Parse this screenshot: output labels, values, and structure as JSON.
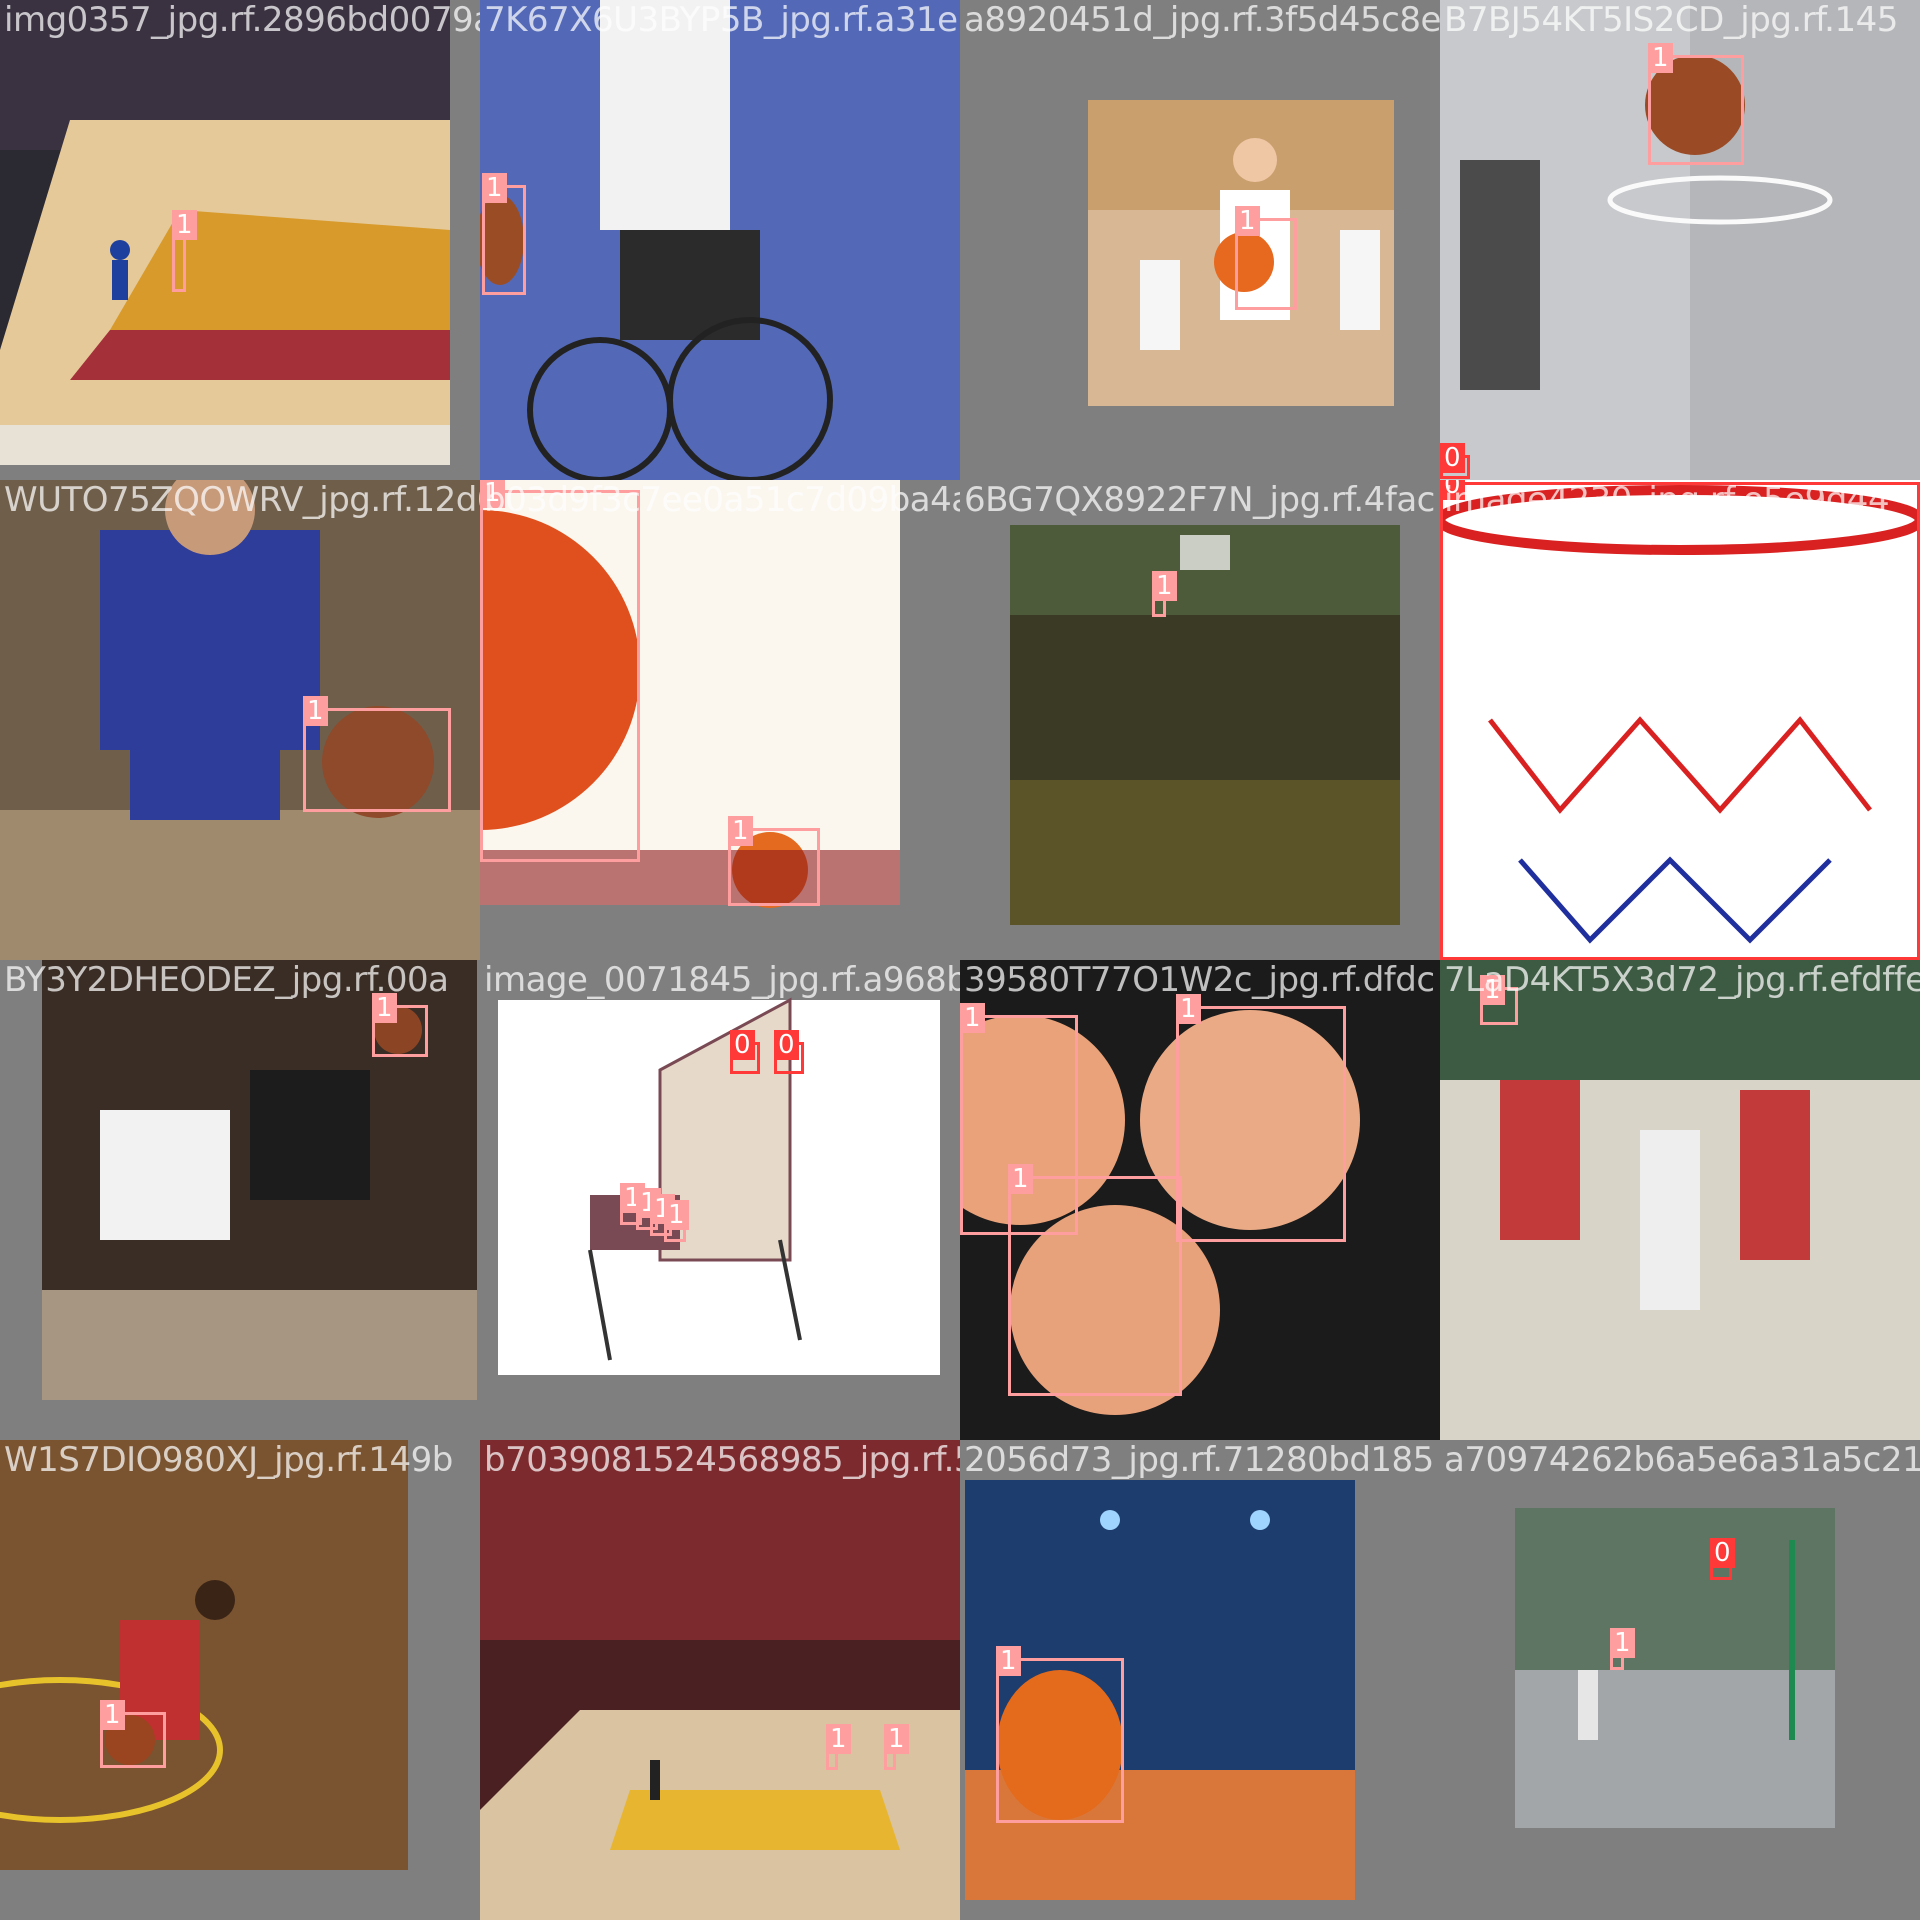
{
  "colors": {
    "class_0": "#ff3838",
    "class_1": "#ff9e9e",
    "background": "#7f7f7f"
  },
  "tiles": [
    {
      "filename": "img0357_jpg.rf.2896bd0079a4f6e7cc0b1b9c59",
      "scene": "court-arena",
      "boxes": [
        {
          "label": "1"
        }
      ]
    },
    {
      "filename": "7K67X6U3BYP5B_jpg.rf.a31e1925160d1a5076805",
      "scene": "wheelchair",
      "boxes": [
        {
          "label": "1"
        }
      ]
    },
    {
      "filename": "a8920451d_jpg.rf.3f5d45c8eaa88301856d3e",
      "scene": "kids",
      "boxes": [
        {
          "label": "1"
        }
      ]
    },
    {
      "filename": "B7BJ54KT5IS2CD_jpg.rf.145",
      "scene": "hoop-statue",
      "boxes": [
        {
          "label": "1"
        },
        {
          "label": "0"
        }
      ]
    },
    {
      "filename": "WUTO75ZQOWRV_jpg.rf.12d0349ff21b99094d36a9ef",
      "scene": "dribble-blue",
      "boxes": [
        {
          "label": "1"
        }
      ]
    },
    {
      "filename": "b03d9f3c7ee0a51c7d09ba4a2",
      "scene": "poster-stars",
      "boxes": [
        {
          "label": "1"
        },
        {
          "label": "1"
        }
      ]
    },
    {
      "filename": "6BG7QX8922F7N_jpg.rf.4fac",
      "scene": "gym-dark",
      "boxes": [
        {
          "label": "1"
        }
      ]
    },
    {
      "filename": "image4230_jpg.rf.e5e9d44",
      "scene": "red-net",
      "boxes": [
        {
          "label": "0"
        }
      ]
    },
    {
      "filename": "BY3Y2DHEODEZ_jpg.rf.00a",
      "scene": "two-players",
      "boxes": [
        {
          "label": "1"
        }
      ]
    },
    {
      "filename": "image_0071845_jpg.rf.a968bc1",
      "scene": "arcade",
      "boxes": [
        {
          "label": "0"
        },
        {
          "label": "0"
        },
        {
          "label": "1"
        },
        {
          "label": "1"
        },
        {
          "label": "1"
        },
        {
          "label": "1"
        }
      ]
    },
    {
      "filename": "39580T77O1W2c_jpg.rf.dfdc",
      "scene": "balls-close",
      "boxes": [
        {
          "label": "1"
        },
        {
          "label": "1"
        },
        {
          "label": "1"
        }
      ]
    },
    {
      "filename": "7LaD4KT5X3d72_jpg.rf.efdffe7",
      "scene": "game-red",
      "boxes": [
        {
          "label": "1"
        }
      ]
    },
    {
      "filename": "W1S7DIO980XJ_jpg.rf.149b",
      "scene": "dribble-red",
      "boxes": [
        {
          "label": "1"
        }
      ]
    },
    {
      "filename": "b7039081524568985_jpg.rf.52fda9726205",
      "scene": "arena-wide",
      "boxes": [
        {
          "label": "1"
        },
        {
          "label": "1"
        }
      ]
    },
    {
      "filename": "2056d73_jpg.rf.71280bd185",
      "scene": "poster-arena",
      "boxes": [
        {
          "label": "1"
        }
      ]
    },
    {
      "filename": "a70974262b6a5e6a31a5c210c",
      "scene": "outdoor-court",
      "boxes": [
        {
          "label": "0"
        },
        {
          "label": "1"
        }
      ]
    }
  ]
}
